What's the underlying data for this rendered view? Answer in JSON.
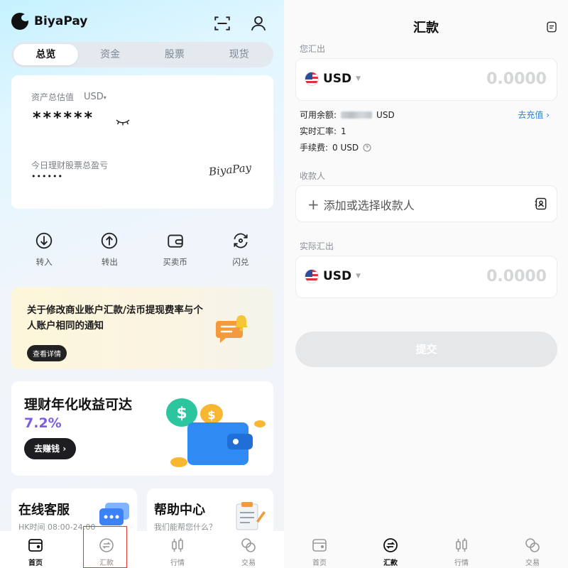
{
  "left": {
    "brand": "BiyaPay",
    "tabs": [
      "总览",
      "资金",
      "股票",
      "现货"
    ],
    "asset": {
      "label": "资产总估值",
      "currency": "USD",
      "hidden_value": "******",
      "today_label": "今日理财股票总盈亏",
      "today_value": "••••••",
      "signature": "BiyaPay"
    },
    "actions": [
      "转入",
      "转出",
      "买卖币",
      "闪兑"
    ],
    "notice": {
      "text": "关于修改商业账户汇款/法币提现费率与个人账户相同的通知",
      "button": "查看详情"
    },
    "promo": {
      "title_prefix": "理财年化收益可达",
      "rate": "7.2%",
      "button": "去赚钱"
    },
    "service": {
      "title": "在线客服",
      "sub": "HK时间 08:00-24:00"
    },
    "help": {
      "title": "帮助中心",
      "sub": "我们能帮您什么？"
    },
    "tabbar": [
      "首页",
      "汇款",
      "行情",
      "交易"
    ]
  },
  "right": {
    "title": "汇款",
    "you_send_label": "您汇出",
    "currency": "USD",
    "amount_placeholder": "0.0000",
    "available_label": "可用余额:",
    "available_unit": "USD",
    "recharge_link": "去充值 ›",
    "rate_label": "实时汇率:",
    "rate_value": "1",
    "fee_label": "手续费:",
    "fee_value": "0 USD",
    "payee_label": "收款人",
    "payee_placeholder": "添加或选择收款人",
    "actual_label": "实际汇出",
    "actual_currency": "USD",
    "actual_amount_placeholder": "0.0000",
    "submit": "提交",
    "tabbar": [
      "首页",
      "汇款",
      "行情",
      "交易"
    ]
  },
  "colors": {
    "accent_purple": "#7c5ce6",
    "link_blue": "#2b7de9",
    "highlight_red": "#e53935"
  }
}
